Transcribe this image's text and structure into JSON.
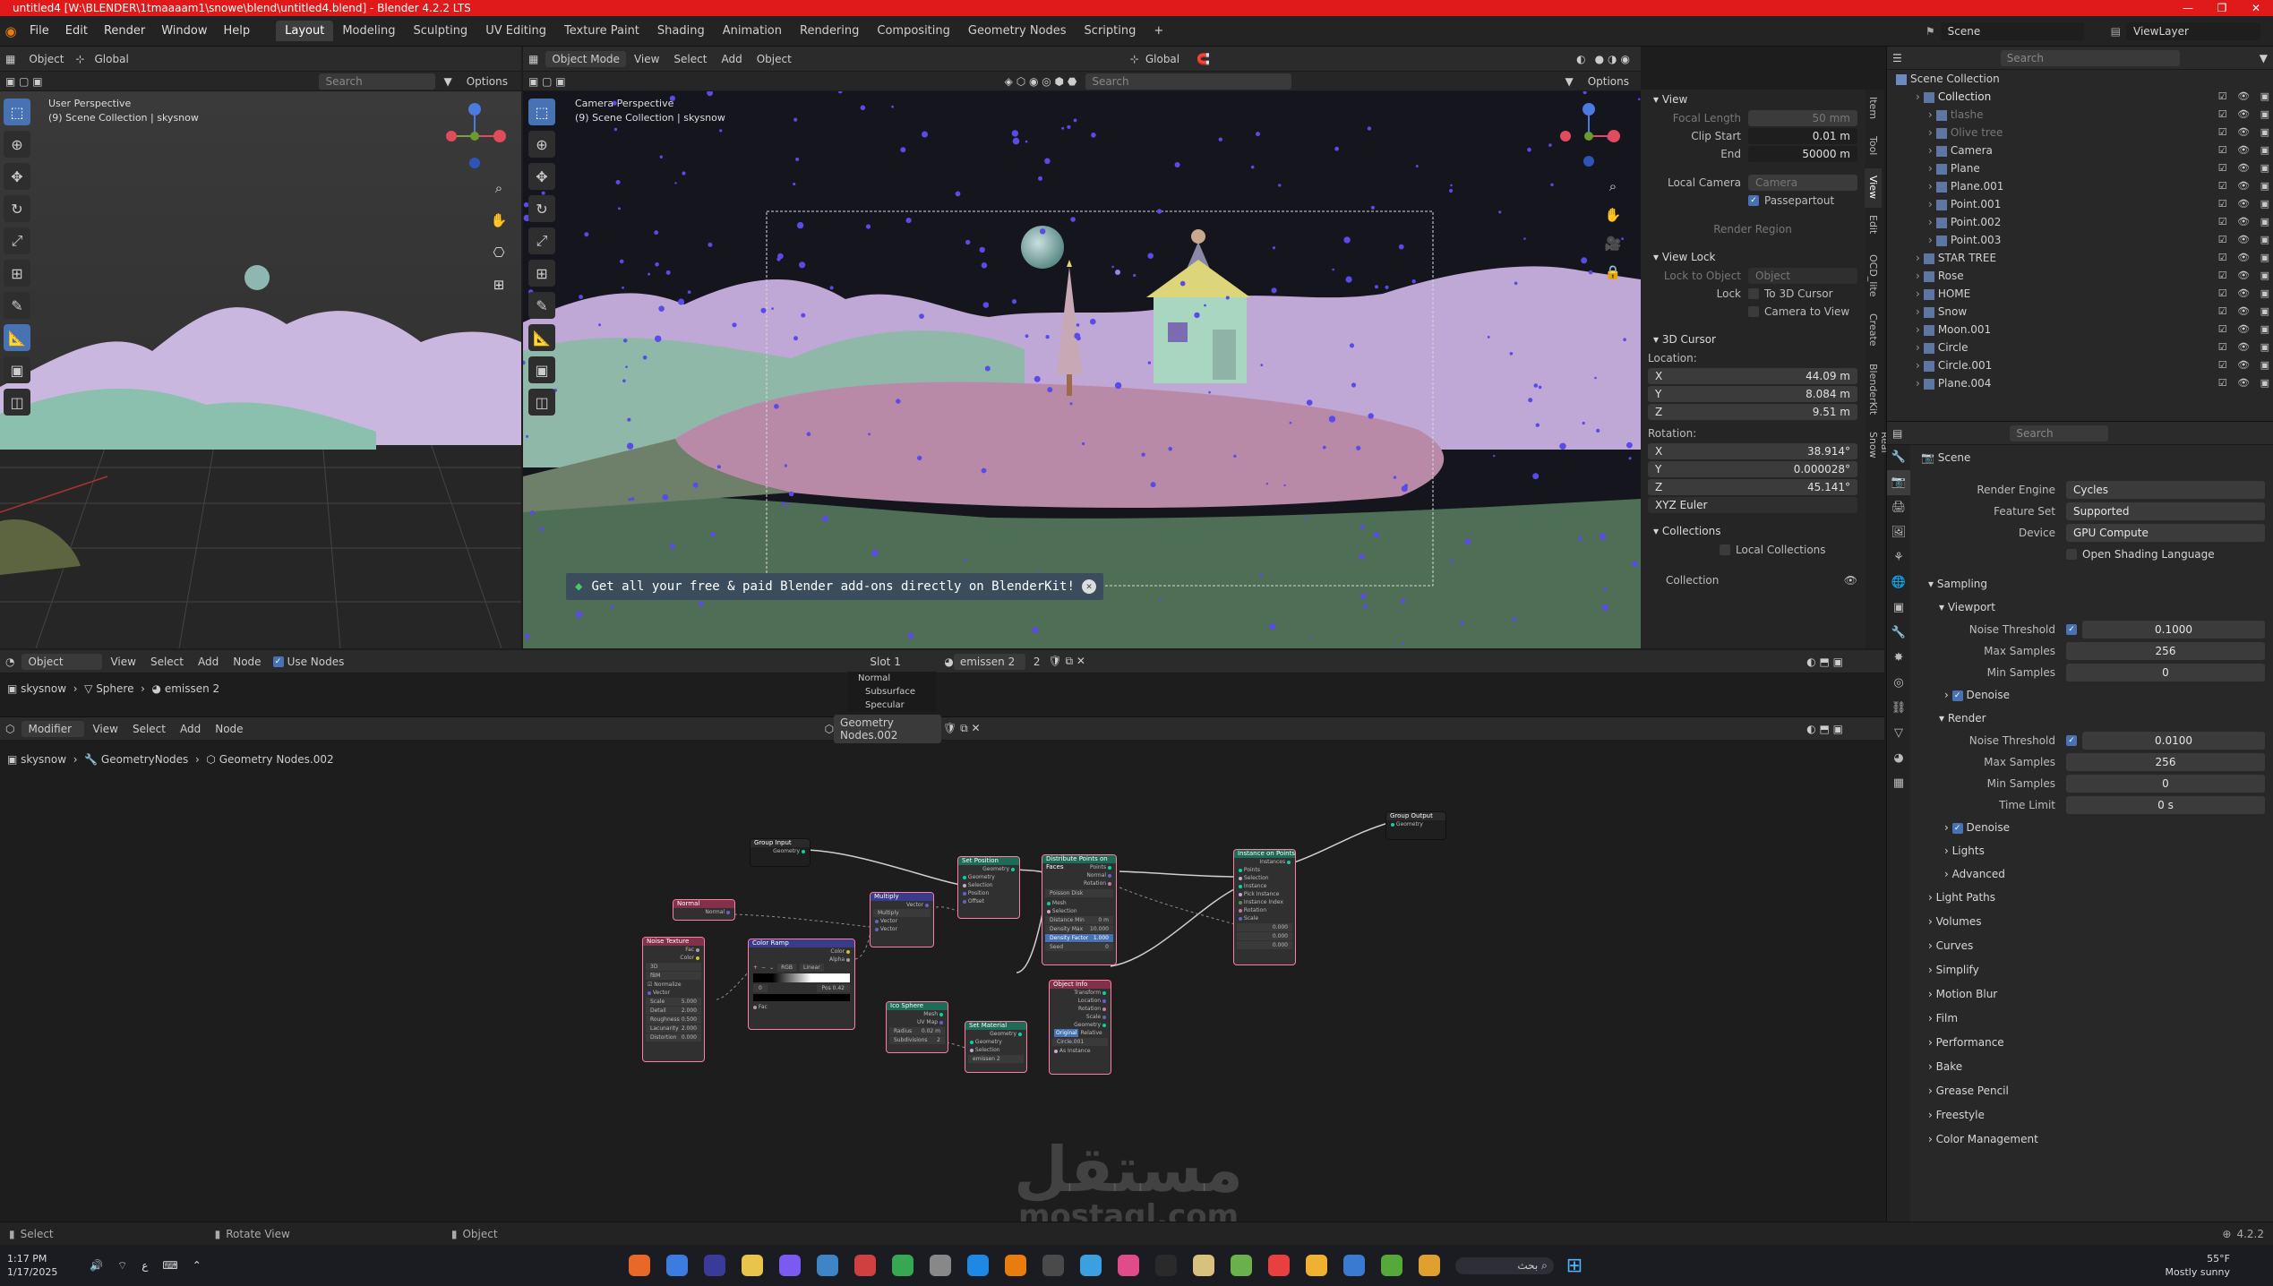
{
  "window": {
    "title": "untitled4 [W:\\BLENDER\\1tmaaaam1\\snowe\\blend\\untitled4.blend] - Blender 4.2.2 LTS",
    "controls": [
      "—",
      "❐",
      "✕"
    ]
  },
  "menubar": {
    "items": [
      "File",
      "Edit",
      "Render",
      "Window",
      "Help"
    ],
    "workspaces": [
      "Layout",
      "Modeling",
      "Sculpting",
      "UV Editing",
      "Texture Paint",
      "Shading",
      "Animation",
      "Rendering",
      "Compositing",
      "Geometry Nodes",
      "Scripting"
    ],
    "active_workspace": "Layout",
    "add_tab": "+",
    "scene_label": "Scene",
    "view_layer_label": "ViewLayer"
  },
  "viewport_left": {
    "header": {
      "object_menu": "Object",
      "transform": "Global",
      "search_placeholder": "Search",
      "options": "Options"
    },
    "perspective": "User Perspective",
    "collection": "(9) Scene Collection | skysnow"
  },
  "viewport_camera": {
    "header": {
      "mode": "Object Mode",
      "view": "View",
      "select": "Select",
      "add": "Add",
      "object": "Object",
      "transform": "Global",
      "search_placeholder": "Search",
      "options": "Options"
    },
    "perspective": "Camera Perspective",
    "collection": "(9) Scene Collection | skysnow",
    "banner_text": "Get all your free & paid Blender add-ons directly on BlenderKit!"
  },
  "sidebar_tabs": [
    "Item",
    "Tool",
    "View",
    "Edit",
    "OCD_lite",
    "Create",
    "BlenderKit",
    "Real Snow"
  ],
  "view_panel": {
    "view_header": "View",
    "focal_length_label": "Focal Length",
    "focal_length": "50 mm",
    "clip_start_label": "Clip Start",
    "clip_start": "0.01 m",
    "end_label": "End",
    "end": "50000 m",
    "local_camera_label": "Local Camera",
    "local_camera_value": "Camera",
    "passepartout_label": "Passepartout",
    "render_region_label": "Render Region",
    "view_lock_header": "View Lock",
    "lock_to_object_label": "Lock to Object",
    "lock_to_object_value": "Object",
    "lock_label": "Lock",
    "to_3d_cursor": "To 3D Cursor",
    "camera_to_view": "Camera to View",
    "cursor_header": "3D Cursor",
    "location_label": "Location:",
    "loc_x": "44.09 m",
    "loc_y": "8.084 m",
    "loc_z": "9.51 m",
    "rotation_label": "Rotation:",
    "rot_x": "38.914°",
    "rot_y": "0.000028°",
    "rot_z": "45.141°",
    "rotation_mode": "XYZ Euler",
    "collections_header": "Collections",
    "local_collections_label": "Local Collections",
    "collection_label": "Collection",
    "axis_x": "X",
    "axis_y": "Y",
    "axis_z": "Z"
  },
  "outliner": {
    "search_placeholder": "Search",
    "root": "Scene Collection",
    "collection": "Collection",
    "items": [
      {
        "name": "Collection",
        "depth": 1,
        "color": "#e0e0e0"
      },
      {
        "name": "tlashe",
        "depth": 2,
        "color": "#777777"
      },
      {
        "name": "Olive tree",
        "depth": 2,
        "color": "#777777"
      },
      {
        "name": "Camera",
        "depth": 2,
        "color": "#d0d0d0"
      },
      {
        "name": "Plane",
        "depth": 2,
        "color": "#d0d0d0"
      },
      {
        "name": "Plane.001",
        "depth": 2,
        "color": "#d0d0d0"
      },
      {
        "name": "Point.001",
        "depth": 2,
        "color": "#d0d0d0"
      },
      {
        "name": "Point.002",
        "depth": 2,
        "color": "#d0d0d0"
      },
      {
        "name": "Point.003",
        "depth": 2,
        "color": "#d0d0d0"
      },
      {
        "name": "STAR TREE",
        "depth": 1,
        "color": "#d0d0d0"
      },
      {
        "name": "Rose",
        "depth": 1,
        "color": "#d0d0d0"
      },
      {
        "name": "HOME",
        "depth": 1,
        "color": "#d0d0d0"
      },
      {
        "name": "Snow",
        "depth": 1,
        "color": "#d0d0d0"
      },
      {
        "name": "Moon.001",
        "depth": 1,
        "color": "#d0d0d0"
      },
      {
        "name": "Circle",
        "depth": 1,
        "color": "#d0d0d0"
      },
      {
        "name": "Circle.001",
        "depth": 1,
        "color": "#d0d0d0"
      },
      {
        "name": "Plane.004",
        "depth": 1,
        "color": "#d0d0d0"
      }
    ]
  },
  "properties": {
    "search_placeholder": "Search",
    "scene_label": "Scene",
    "render_engine_label": "Render Engine",
    "render_engine": "Cycles",
    "feature_set_label": "Feature Set",
    "feature_set": "Supported",
    "device_label": "Device",
    "device": "GPU Compute",
    "osl_label": "Open Shading Language",
    "sampling": "Sampling",
    "viewport": "Viewport",
    "noise_threshold_label": "Noise Threshold",
    "vp_noise_threshold": "0.1000",
    "max_samples_label": "Max Samples",
    "vp_max_samples": "256",
    "min_samples_label": "Min Samples",
    "vp_min_samples": "0",
    "denoise_label": "Denoise",
    "render": "Render",
    "r_noise_threshold": "0.0100",
    "r_max_samples": "256",
    "r_min_samples": "0",
    "time_limit_label": "Time Limit",
    "time_limit": "0 s",
    "lights": "Lights",
    "advanced": "Advanced",
    "sections": [
      "Light Paths",
      "Volumes",
      "Curves",
      "Simplify",
      "Motion Blur",
      "Film",
      "Performance",
      "Bake",
      "Grease Pencil",
      "Freestyle",
      "Color Management"
    ]
  },
  "shader_editor": {
    "object_menu": "Object",
    "view": "View",
    "select": "Select",
    "add": "Add",
    "node": "Node",
    "use_nodes": "Use Nodes",
    "slot": "Slot 1",
    "material": "emissen 2",
    "users": "2",
    "breadcrumb": [
      "skysnow",
      "Sphere",
      "emissen 2"
    ],
    "popup": [
      "Normal",
      "Subsurface",
      "Specular"
    ]
  },
  "geo_editor": {
    "modifier_menu": "Modifier",
    "view": "View",
    "select": "Select",
    "add": "Add",
    "node": "Node",
    "tree_name": "Geometry Nodes.002",
    "breadcrumb": [
      "skysnow",
      "GeometryNodes",
      "Geometry Nodes.002"
    ]
  },
  "nodes": {
    "group_input": "Group Input",
    "group_output": "Group Output",
    "normal": "Normal",
    "set_position": "Set Position",
    "distribute": "Distribute Points on Faces",
    "instance": "Instance on Points",
    "multiply": "Multiply",
    "noise": "Noise Texture",
    "color_ramp": "Color Ramp",
    "ico_sphere": "Ico Sphere",
    "set_material": "Set Material",
    "object_info": "Object Info",
    "geometry": "Geometry",
    "selection": "Selection",
    "position": "Position",
    "offset": "Offset",
    "points": "Points",
    "rotation": "Rotation",
    "instance_sock": "Instance",
    "instances": "Instances",
    "scale": "Scale",
    "vector": "Vector",
    "fac": "Fac",
    "color": "Color",
    "alpha": "Alpha",
    "mesh": "Mesh",
    "radius": "Radius",
    "subdivisions": "Subdivisions",
    "material": "Material",
    "poisson_disk": "Poisson Disk",
    "distance_min": "Distance Min",
    "density_max": "Density Max",
    "density_factor": "Density Factor",
    "seed": "Seed",
    "pick_instance": "Pick Instance",
    "instance_index": "Instance Index",
    "dim_3d": "3D",
    "fbm": "fBM",
    "normalize": "Normalize",
    "detail": "Detail",
    "roughness": "Roughness",
    "lacunarity": "Lacunarity",
    "distortion": "Distortion",
    "rgb": "RGB",
    "linear": "Linear",
    "pos_label": "Pos",
    "pos_value": "0.42",
    "radius_value": "0.02 m",
    "subdivisions_value": "2",
    "scale_value": "5.000",
    "detail_value": "2.000",
    "roughness_value": "0.500",
    "lacunarity_value": "2.000",
    "distortion_value": "0.000",
    "ramp_index": "0",
    "distance_min_value": "0 m",
    "density_max_value": "10.000",
    "density_factor_value": "1.000",
    "seed_value": "0",
    "material_value": "emissen 2",
    "original": "Original",
    "relative": "Relative",
    "object_value": "Circle.001",
    "as_instance": "As Instance",
    "transform": "Transform",
    "location": "Location",
    "geometry_sock": "Geometry",
    "instance_scale": "0.000"
  },
  "statusbar": {
    "select": "Select",
    "rotate": "Rotate View",
    "object": "Object",
    "version": "4.2.2"
  },
  "taskbar": {
    "time": "1:17 PM",
    "date": "1/17/2025",
    "search": "بحث",
    "weather_temp": "55°F",
    "weather_desc": "Mostly sunny",
    "lang": "ع"
  },
  "watermark": {
    "ar": "مستقل",
    "en": "mostaql.com"
  },
  "colors": {
    "accent": "#4772b3",
    "title": "#e01a1a",
    "selected_node": "#ff7fa0"
  }
}
